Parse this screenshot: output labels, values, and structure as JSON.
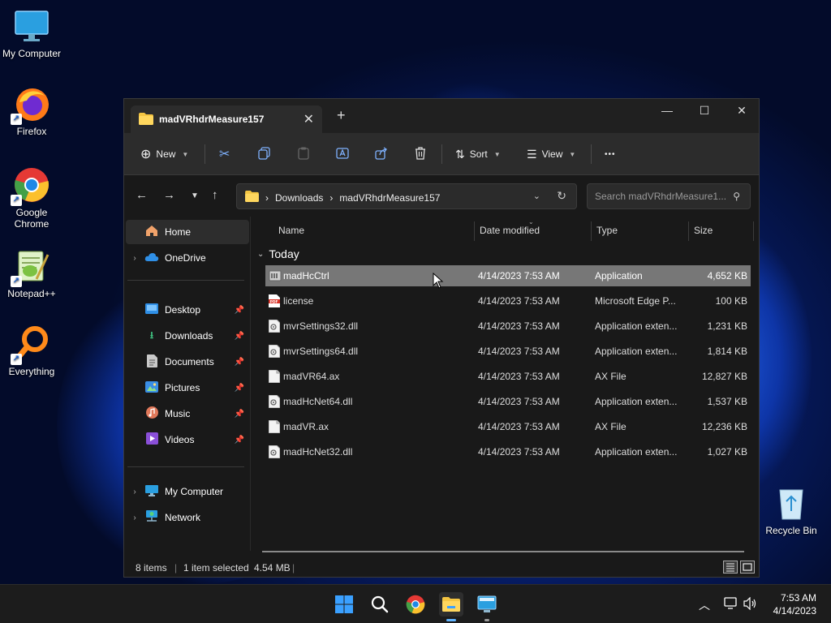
{
  "desktop": {
    "icons": [
      {
        "label": "My Computer"
      },
      {
        "label": "Firefox"
      },
      {
        "label": "Google Chrome"
      },
      {
        "label": "Notepad++"
      },
      {
        "label": "Everything"
      },
      {
        "label": "Recycle Bin"
      }
    ]
  },
  "window": {
    "tab_title": "madVRhdrMeasure157",
    "new_tab_glyph": "+",
    "controls": {
      "minimize": "—",
      "maximize": "☐",
      "close": "✕"
    },
    "toolbar": {
      "new_label": "New",
      "sort_label": "Sort",
      "view_label": "View",
      "more_glyph": "•••"
    },
    "address": {
      "crumbs": [
        "Downloads",
        "madVRhdrMeasure157"
      ],
      "separator": "›"
    },
    "search_placeholder": "Search madVRhdrMeasure1...",
    "sidebar": {
      "home": "Home",
      "onedrive": "OneDrive",
      "quick": [
        {
          "label": "Desktop"
        },
        {
          "label": "Downloads"
        },
        {
          "label": "Documents"
        },
        {
          "label": "Pictures"
        },
        {
          "label": "Music"
        },
        {
          "label": "Videos"
        }
      ],
      "my_computer": "My Computer",
      "network": "Network"
    },
    "columns": {
      "name": "Name",
      "date": "Date modified",
      "type": "Type",
      "size": "Size"
    },
    "group": "Today",
    "files": [
      {
        "name": "madHcCtrl",
        "date": "4/14/2023 7:53 AM",
        "type": "Application",
        "size": "4,652 KB",
        "icon": "app-icon"
      },
      {
        "name": "license",
        "date": "4/14/2023 7:53 AM",
        "type": "Microsoft Edge P...",
        "size": "100 KB",
        "icon": "pdf-icon"
      },
      {
        "name": "mvrSettings32.dll",
        "date": "4/14/2023 7:53 AM",
        "type": "Application exten...",
        "size": "1,231 KB",
        "icon": "dll-icon"
      },
      {
        "name": "mvrSettings64.dll",
        "date": "4/14/2023 7:53 AM",
        "type": "Application exten...",
        "size": "1,814 KB",
        "icon": "dll-icon"
      },
      {
        "name": "madVR64.ax",
        "date": "4/14/2023 7:53 AM",
        "type": "AX File",
        "size": "12,827 KB",
        "icon": "file-icon"
      },
      {
        "name": "madHcNet64.dll",
        "date": "4/14/2023 7:53 AM",
        "type": "Application exten...",
        "size": "1,537 KB",
        "icon": "dll-icon"
      },
      {
        "name": "madVR.ax",
        "date": "4/14/2023 7:53 AM",
        "type": "AX File",
        "size": "12,236 KB",
        "icon": "file-icon"
      },
      {
        "name": "madHcNet32.dll",
        "date": "4/14/2023 7:53 AM",
        "type": "Application exten...",
        "size": "1,027 KB",
        "icon": "dll-icon"
      }
    ],
    "status": {
      "items": "8 items",
      "selected": "1 item selected",
      "selected_size": "4.54 MB"
    }
  },
  "taskbar": {
    "time": "7:53 AM",
    "date": "4/14/2023"
  },
  "colors": {
    "selection": "#777777",
    "window_bg": "#191919",
    "toolbar_bg": "#2c2c2c",
    "folder": "#f4c542"
  }
}
